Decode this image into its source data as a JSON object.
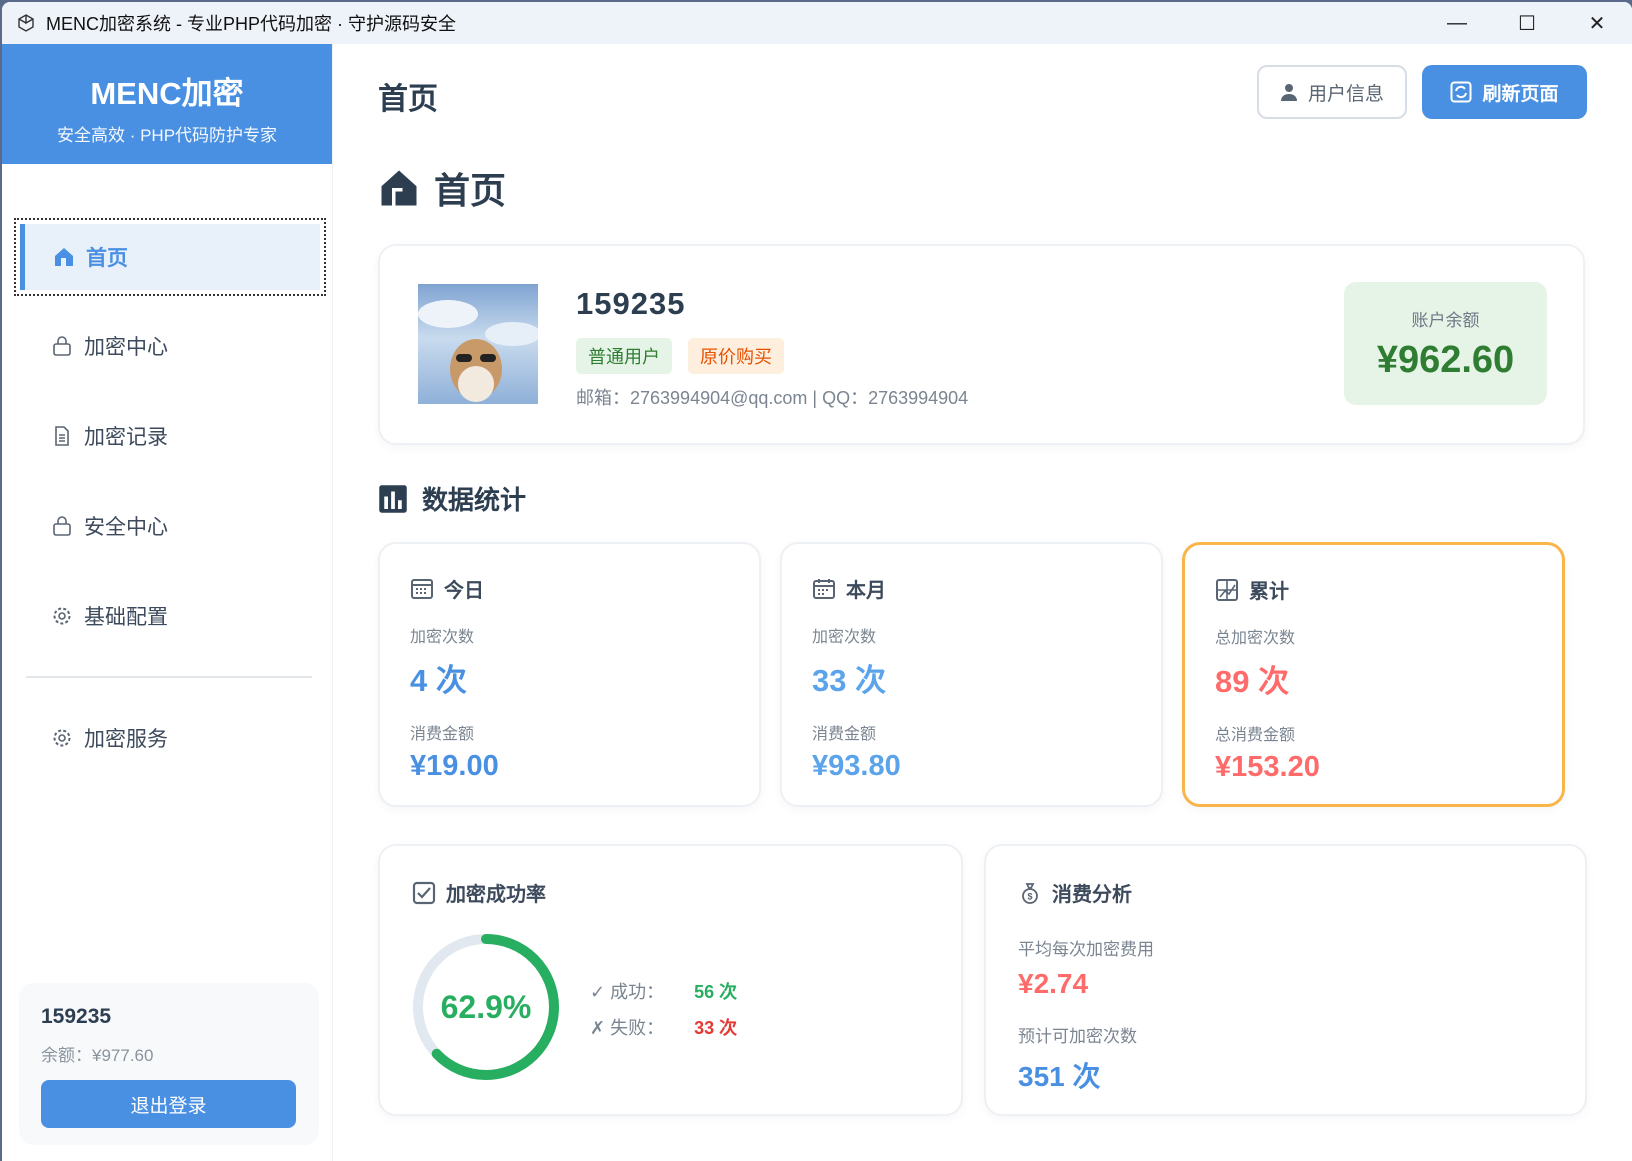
{
  "window": {
    "title": "MENC加密系统 - 专业PHP代码加密 · 守护源码安全",
    "minimize": "—",
    "maximize": "☐",
    "close": "✕"
  },
  "brand": {
    "name": "MENC加密",
    "slogan": "安全高效 · PHP代码防护专家"
  },
  "nav": [
    {
      "label": "首页",
      "icon": "home-icon"
    },
    {
      "label": "加密中心",
      "icon": "lock-icon"
    },
    {
      "label": "加密记录",
      "icon": "document-icon"
    },
    {
      "label": "安全中心",
      "icon": "lock-icon"
    },
    {
      "label": "基础配置",
      "icon": "gear-icon"
    },
    {
      "label": "加密服务",
      "icon": "gear-icon"
    }
  ],
  "sidebar_user": {
    "id": "159235",
    "balance": "余额：¥977.60",
    "logout": "退出登录"
  },
  "header": {
    "title": "首页",
    "user_info": "用户信息",
    "refresh": "刷新页面"
  },
  "page_heading": "首页",
  "profile": {
    "id": "159235",
    "tags": [
      "普通用户",
      "原价购买"
    ],
    "contact": "邮箱：2763994904@qq.com  |  QQ：2763994904",
    "balance_label": "账户余额",
    "balance": "¥962.60"
  },
  "stats_heading": "数据统计",
  "stats": [
    {
      "title": "今日",
      "count_label": "加密次数",
      "count": "4 次",
      "amount_label": "消费金额",
      "amount": "¥19.00"
    },
    {
      "title": "本月",
      "count_label": "加密次数",
      "count": "33 次",
      "amount_label": "消费金额",
      "amount": "¥93.80"
    },
    {
      "title": "累计",
      "count_label": "总加密次数",
      "count": "89 次",
      "amount_label": "总消费金额",
      "amount": "¥153.20"
    }
  ],
  "success": {
    "title": "加密成功率",
    "rate": "62.9%",
    "rate_value": 0.629,
    "success_label": "✓ 成功：",
    "success": "56 次",
    "fail_label": "✗ 失败：",
    "fail": "33 次"
  },
  "analysis": {
    "title": "消费分析",
    "avg_label": "平均每次加密费用",
    "avg": "¥2.74",
    "est_label": "预计可加密次数",
    "est": "351 次"
  },
  "colors": {
    "primary": "#4a90e2",
    "green": "#27ae60",
    "red": "#ff6b6b",
    "orange": "#f9b549"
  }
}
